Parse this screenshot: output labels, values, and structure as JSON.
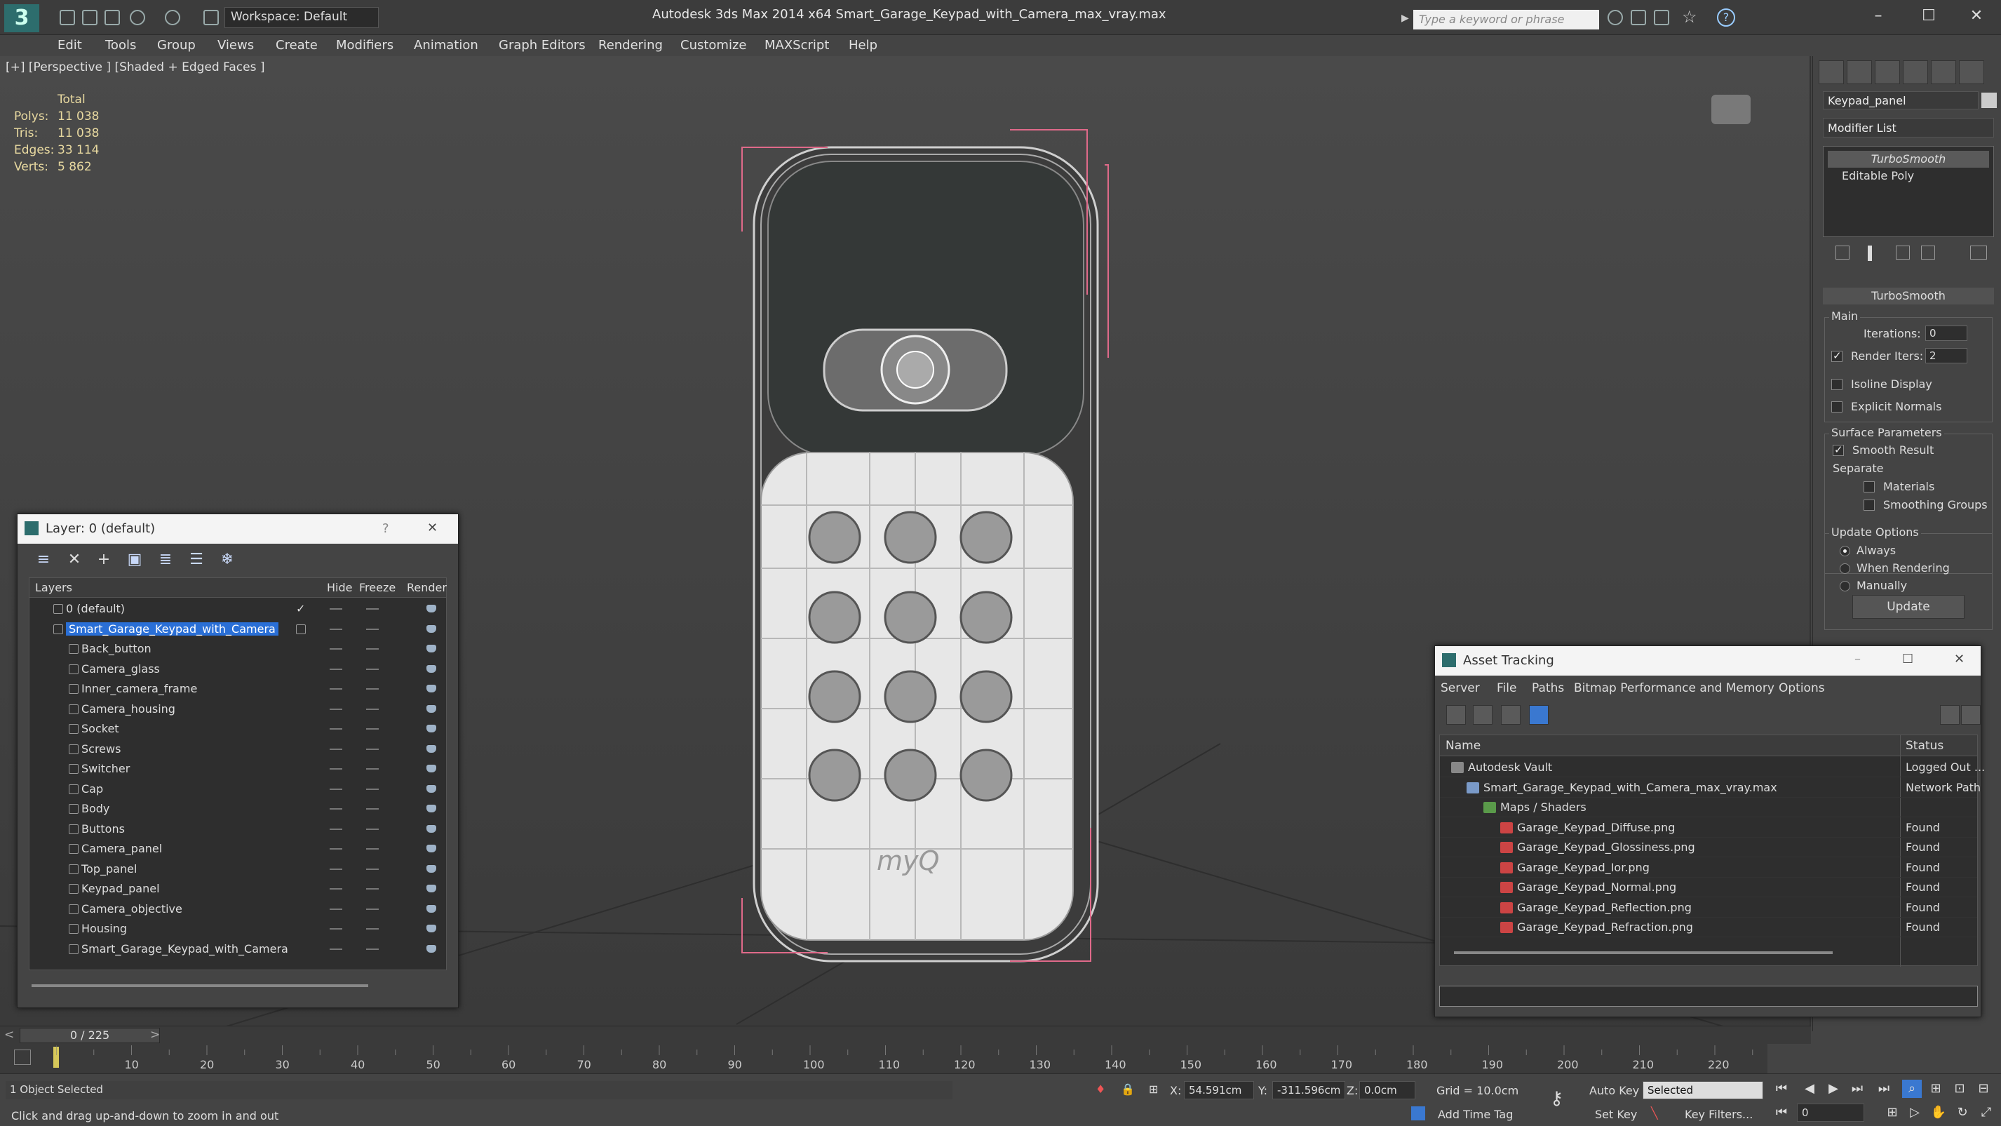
{
  "title_bar": {
    "workspace": "Workspace: Default",
    "app_title": "Autodesk 3ds Max  2014 x64      Smart_Garage_Keypad_with_Camera_max_vray.max",
    "search_placeholder": "Type a keyword or phrase",
    "minimize": "–",
    "maximize": "☐",
    "close": "✕"
  },
  "menu": [
    "Edit",
    "Tools",
    "Group",
    "Views",
    "Create",
    "Modifiers",
    "Animation",
    "Graph Editors",
    "Rendering",
    "Customize",
    "MAXScript",
    "Help"
  ],
  "viewport": {
    "label": "[+] [Perspective ] [Shaded + Edged Faces ]",
    "stats": {
      "header": "Total",
      "rows": [
        {
          "label": "Polys:",
          "value": "11 038"
        },
        {
          "label": "Tris:",
          "value": "11 038"
        },
        {
          "label": "Edges:",
          "value": "33 114"
        },
        {
          "label": "Verts:",
          "value": "5 862"
        }
      ]
    }
  },
  "command_panel": {
    "object_name": "Keypad_panel",
    "modifier_list": "Modifier List",
    "stack": [
      "TurboSmooth",
      "Editable Poly"
    ],
    "rollout": "TurboSmooth",
    "main_group": "Main",
    "iterations_label": "Iterations:",
    "iterations_value": "0",
    "render_iters_label": "Render Iters:",
    "render_iters_value": "2",
    "isoline": "Isoline Display",
    "explicit_normals": "Explicit Normals",
    "surface_group": "Surface Parameters",
    "smooth_result": "Smooth Result",
    "separate": "Separate",
    "materials": "Materials",
    "smoothing_groups": "Smoothing Groups",
    "update_group": "Update Options",
    "always": "Always",
    "when_rendering": "When Rendering",
    "manually": "Manually",
    "update_button": "Update"
  },
  "layer_dialog": {
    "title": "Layer: 0 (default)",
    "help": "?",
    "close": "✕",
    "columns": {
      "layers": "Layers",
      "hide": "Hide",
      "freeze": "Freeze",
      "render": "Render"
    },
    "rows": [
      {
        "name": "0 (default)",
        "level": 0
      },
      {
        "name": "Smart_Garage_Keypad_with_Camera",
        "level": 0
      },
      {
        "name": "Back_button",
        "level": 1
      },
      {
        "name": "Camera_glass",
        "level": 1
      },
      {
        "name": "Inner_camera_frame",
        "level": 1
      },
      {
        "name": "Camera_housing",
        "level": 1
      },
      {
        "name": "Socket",
        "level": 1
      },
      {
        "name": "Screws",
        "level": 1
      },
      {
        "name": "Switcher",
        "level": 1
      },
      {
        "name": "Cap",
        "level": 1
      },
      {
        "name": "Body",
        "level": 1
      },
      {
        "name": "Buttons",
        "level": 1
      },
      {
        "name": "Camera_panel",
        "level": 1
      },
      {
        "name": "Top_panel",
        "level": 1
      },
      {
        "name": "Keypad_panel",
        "level": 1
      },
      {
        "name": "Camera_objective",
        "level": 1
      },
      {
        "name": "Housing",
        "level": 1
      },
      {
        "name": "Smart_Garage_Keypad_with_Camera",
        "level": 1
      }
    ]
  },
  "asset_dialog": {
    "title": "Asset Tracking",
    "menu": [
      "Server",
      "File",
      "Paths",
      "Bitmap Performance and Memory",
      "Options"
    ],
    "columns": {
      "name": "Name",
      "status": "Status"
    },
    "rows": [
      {
        "name": "Autodesk Vault",
        "status": "Logged Out ...",
        "level": 0
      },
      {
        "name": "Smart_Garage_Keypad_with_Camera_max_vray.max",
        "status": "Network Path",
        "level": 1
      },
      {
        "name": "Maps / Shaders",
        "status": "",
        "level": 2
      },
      {
        "name": "Garage_Keypad_Diffuse.png",
        "status": "Found",
        "level": 3
      },
      {
        "name": "Garage_Keypad_Glossiness.png",
        "status": "Found",
        "level": 3
      },
      {
        "name": "Garage_Keypad_Ior.png",
        "status": "Found",
        "level": 3
      },
      {
        "name": "Garage_Keypad_Normal.png",
        "status": "Found",
        "level": 3
      },
      {
        "name": "Garage_Keypad_Reflection.png",
        "status": "Found",
        "level": 3
      },
      {
        "name": "Garage_Keypad_Refraction.png",
        "status": "Found",
        "level": 3
      }
    ]
  },
  "timeline": {
    "frame": "0 / 225",
    "ticks": [
      "10",
      "20",
      "30",
      "40",
      "50",
      "60",
      "70",
      "80",
      "90",
      "100",
      "110",
      "120",
      "130",
      "140",
      "150",
      "160",
      "170",
      "180",
      "190",
      "200",
      "210",
      "220"
    ]
  },
  "status": {
    "selected": "1 Object Selected",
    "prompt": "Click and drag up-and-down to zoom in and out",
    "x_label": "X:",
    "x_value": "54.591cm",
    "y_label": "Y:",
    "y_value": "-311.596cm",
    "z_label": "Z:",
    "z_value": "0.0cm",
    "grid": "Grid = 10.0cm",
    "add_time_tag": "Add Time Tag",
    "auto_key": "Auto Key",
    "selected_dropdown": "Selected",
    "set_key": "Set Key",
    "key_filters": "Key Filters...",
    "frame_field": "0"
  },
  "model_logo": "myQ"
}
